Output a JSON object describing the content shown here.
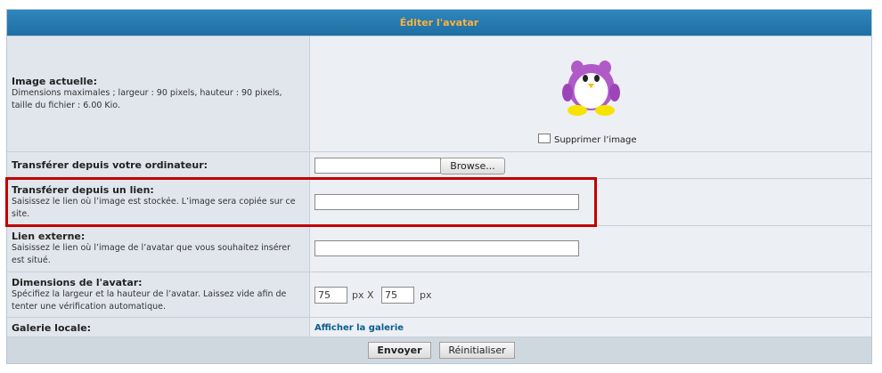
{
  "header": {
    "title": "Éditer l'avatar"
  },
  "current_image": {
    "title": "Image actuelle:",
    "description": "Dimensions maximales ; largeur : 90 pixels, hauteur : 90 pixels, taille du fichier : 6.00 Kio.",
    "delete_label": "Supprimer l’image",
    "delete_checked": false
  },
  "upload_computer": {
    "title": "Transférer depuis votre ordinateur:",
    "file_value": "",
    "browse_label": "Browse..."
  },
  "upload_link": {
    "title": "Transférer depuis un lien:",
    "description": "Saisissez le lien où l’image est stockée. L’image sera copiée sur ce site.",
    "value": ""
  },
  "external_link": {
    "title": "Lien externe:",
    "description": "Saisissez le lien où l’image de l’avatar que vous souhaitez insérer est situé.",
    "value": ""
  },
  "dimensions": {
    "title": "Dimensions de l'avatar:",
    "description": "Spécifiez la largeur et la hauteur de l’avatar. Laissez vide afin de tenter une vérification automatique.",
    "width_value": "75",
    "height_value": "75",
    "px_label_1": "px X",
    "px_label_2": "px"
  },
  "gallery": {
    "title": "Galerie locale:",
    "link_label": "Afficher la galerie"
  },
  "footer": {
    "submit_label": "Envoyer",
    "reset_label": "Réinitialiser"
  },
  "colors": {
    "header_bg": "#1e6fa3",
    "header_text": "#ffb23a",
    "highlight_border": "#c00000",
    "link": "#0a5d8e"
  },
  "icons": {
    "avatar": "penguin-avatar"
  }
}
